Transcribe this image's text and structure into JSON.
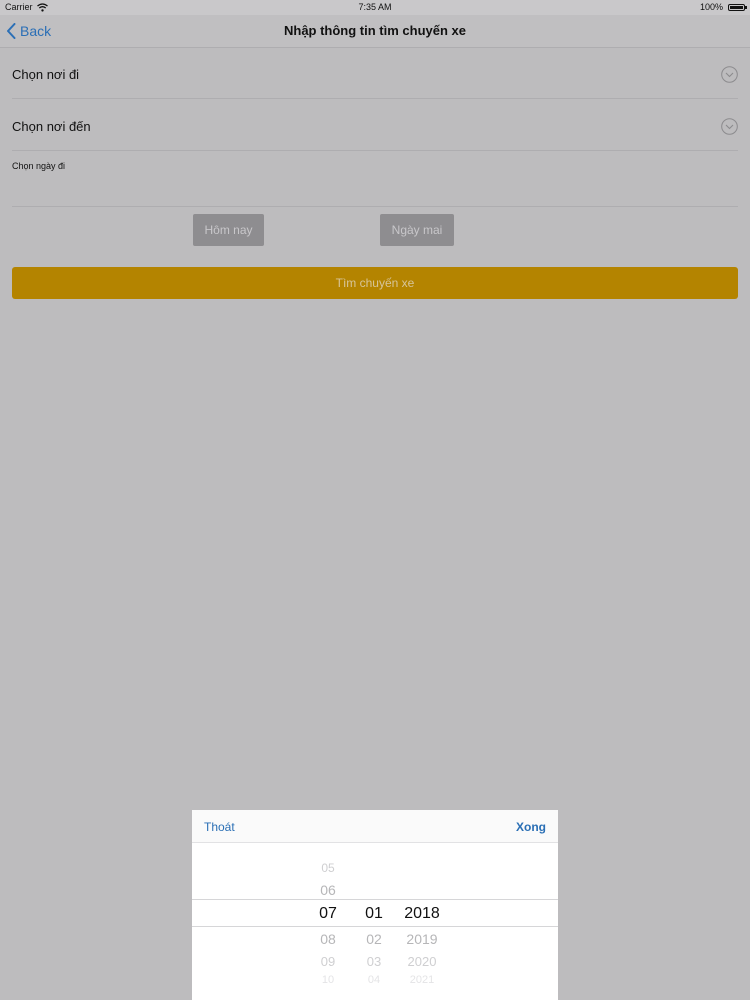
{
  "status_bar": {
    "carrier": "Carrier",
    "time": "7:35 AM",
    "battery": "100%"
  },
  "nav": {
    "back_label": "Back",
    "title": "Nhập thông tin tìm chuyến xe"
  },
  "form": {
    "origin_label": "Chọn nơi đi",
    "destination_label": "Chọn nơi đến",
    "date_label": "Chọn ngày đi",
    "today_button": "Hôm nay",
    "tomorrow_button": "Ngày mai",
    "search_button": "Tìm chuyến xe"
  },
  "picker": {
    "cancel_label": "Thoát",
    "done_label": "Xong",
    "month": {
      "above": [
        "05",
        "06"
      ],
      "selected": "07",
      "below": [
        "08",
        "09",
        "10"
      ]
    },
    "day": {
      "above": [],
      "selected": "01",
      "below": [
        "02",
        "03",
        "04"
      ]
    },
    "year": {
      "above": [],
      "selected": "2018",
      "below": [
        "2019",
        "2020",
        "2021"
      ]
    }
  },
  "colors": {
    "accent": "#2b6fb6",
    "search_button_bg": "#b48400",
    "dim_overlay": "#bdbcbe"
  }
}
